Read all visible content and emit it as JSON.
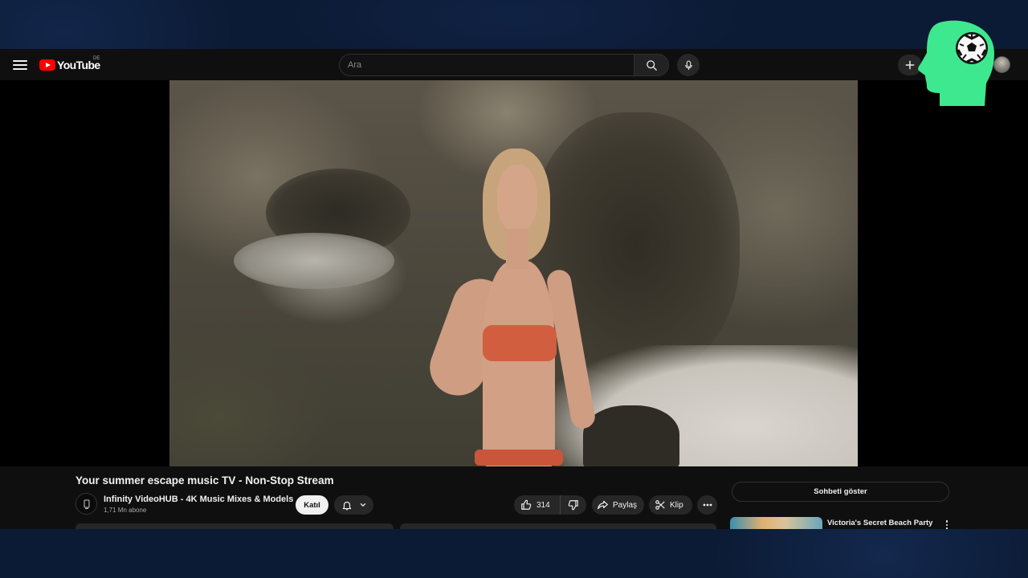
{
  "header": {
    "logo_text": "YouTube",
    "country_code": "DE",
    "search_placeholder": "Ara"
  },
  "video": {
    "title": "Your summer escape music TV - Non-Stop Stream"
  },
  "channel": {
    "name": "Infinity VideoHUB - 4K Music Mixes & Models",
    "subscribers": "1,71 Mn abone",
    "join_label": "Katıl"
  },
  "actions": {
    "like_count": "314",
    "share_label": "Paylaş",
    "clip_label": "Klip"
  },
  "sidebar": {
    "chat_button_label": "Sohbeti göster",
    "recommendation_title": "Victoria's Secret Beach Party"
  },
  "colors": {
    "brand_red": "#ff0000",
    "overlay_logo_green": "#3ee88e",
    "page_background": "#0f0f0f"
  },
  "icons": [
    "menu-icon",
    "search-icon",
    "microphone-icon",
    "create-icon",
    "bell-icon",
    "chevron-down-icon",
    "thumbs-up-icon",
    "thumbs-down-icon",
    "share-icon",
    "scissors-icon",
    "more-icon",
    "kebab-icon",
    "soccer-ball-icon"
  ]
}
